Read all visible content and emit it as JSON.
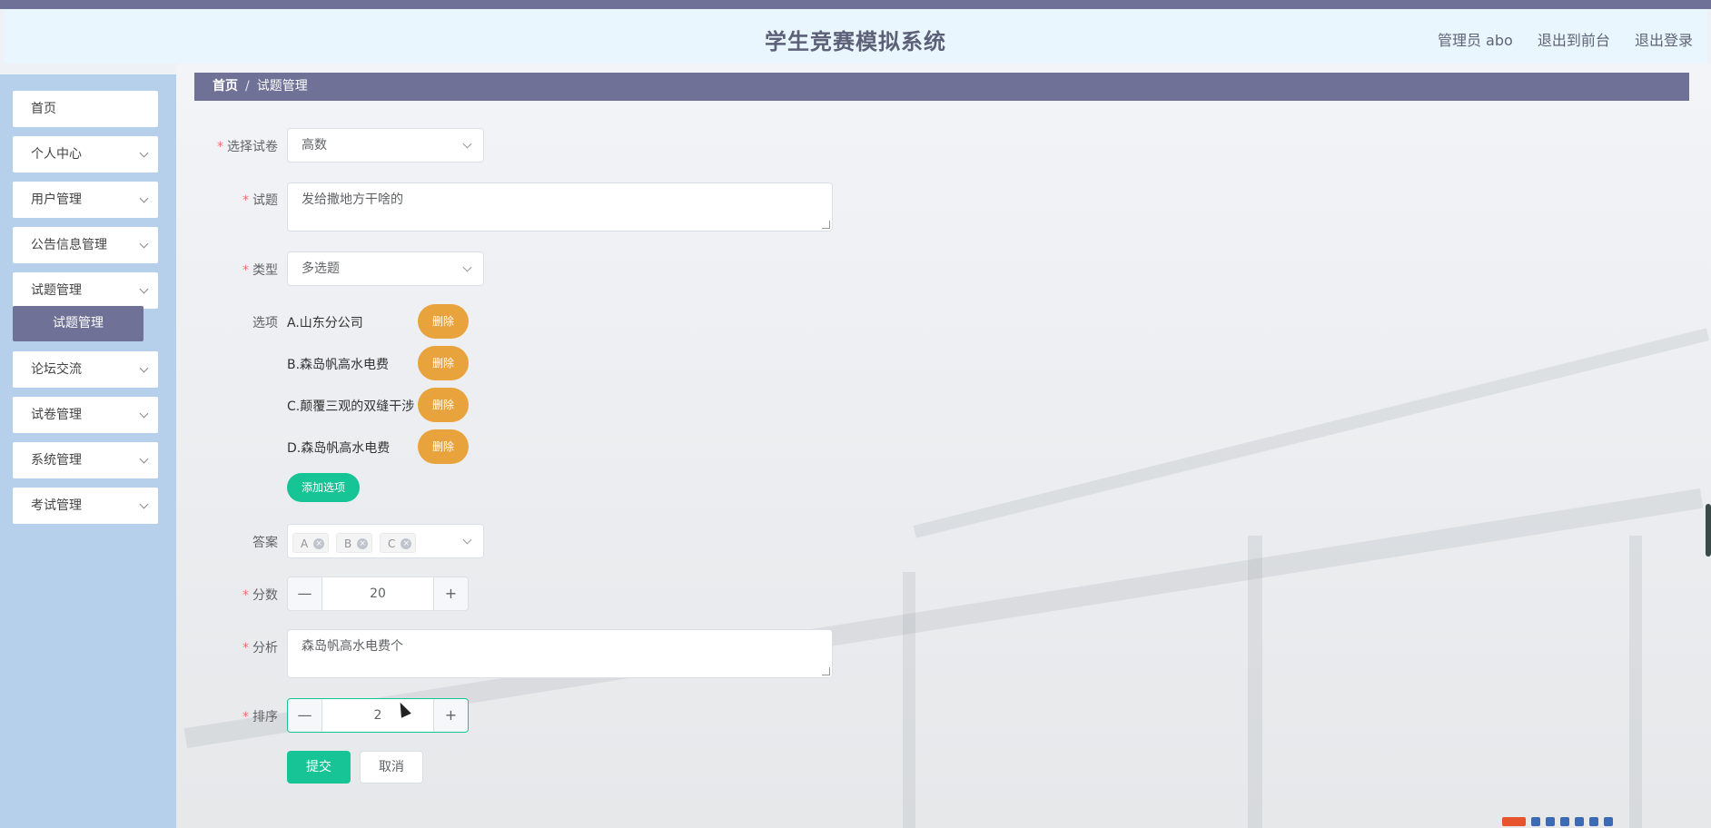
{
  "header": {
    "title": "学生竞赛模拟系统",
    "user": "管理员 abo",
    "to_front": "退出到前台",
    "logout": "退出登录"
  },
  "sidebar": {
    "items": [
      {
        "label": "首页"
      },
      {
        "label": "个人中心"
      },
      {
        "label": "用户管理"
      },
      {
        "label": "公告信息管理"
      },
      {
        "label": "试题管理"
      },
      {
        "label": "论坛交流"
      },
      {
        "label": "试卷管理"
      },
      {
        "label": "系统管理"
      },
      {
        "label": "考试管理"
      }
    ],
    "active_sub": "试题管理"
  },
  "breadcrumb": {
    "home": "首页",
    "sep": "/",
    "current": "试题管理"
  },
  "form": {
    "req_mark": "*",
    "paper": {
      "label": "选择试卷",
      "value": "高数"
    },
    "question": {
      "label": "试题",
      "value": "发给撒地方干啥的"
    },
    "type": {
      "label": "类型",
      "value": "多选题"
    },
    "options": {
      "label": "选项",
      "items": [
        {
          "text": "A.山东分公司",
          "delete": "删除"
        },
        {
          "text": "B.森岛帆高水电费",
          "delete": "删除"
        },
        {
          "text": "C.颠覆三观的双缝干涉",
          "delete": "删除"
        },
        {
          "text": "D.森岛帆高水电费",
          "delete": "删除"
        }
      ],
      "add": "添加选项"
    },
    "answer": {
      "label": "答案",
      "tags": [
        "A",
        "B",
        "C"
      ]
    },
    "score": {
      "label": "分数",
      "value": "20"
    },
    "analysis": {
      "label": "分析",
      "value": "森岛帆高水电费个"
    },
    "order": {
      "label": "排序",
      "value": "2"
    },
    "submit": "提交",
    "cancel": "取消",
    "minus": "—",
    "plus": "+"
  },
  "colors": {
    "accent": "#6f7196",
    "primary": "#17c495",
    "warning": "#e8a33d"
  }
}
